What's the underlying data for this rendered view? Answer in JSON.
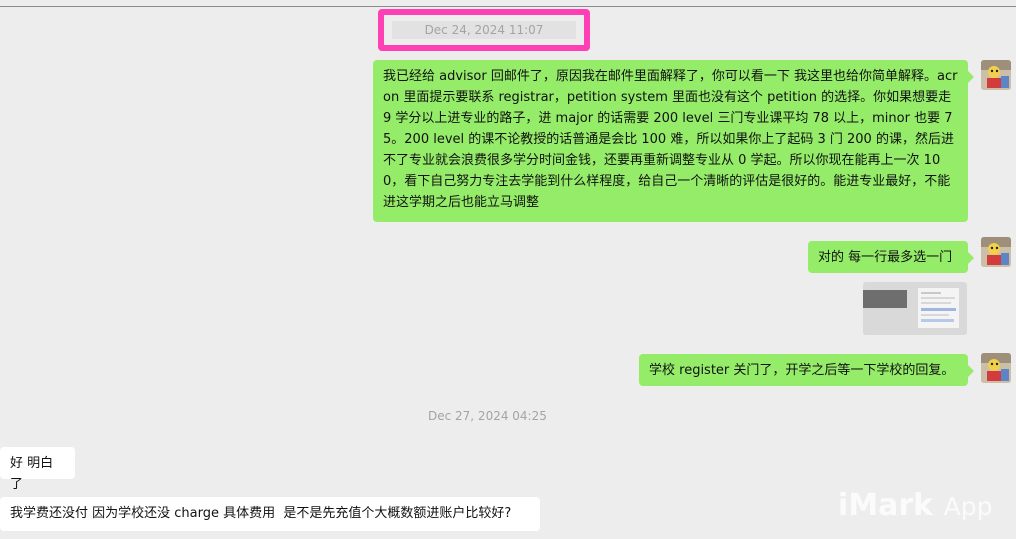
{
  "timestamps": {
    "first": "Dec 24, 2024 11:07",
    "second": "Dec 27, 2024 04:25"
  },
  "messages": {
    "m1": "我已经给 advisor 回邮件了，原因我在邮件里面解释了，你可以看一下 我这里也给你简单解释。acron 里面提示要联系 registrar，petition system 里面也没有这个 petition 的选择。你如果想要走 9 学分以上进专业的路子，进 major 的话需要 200 level 三门专业课平均 78 以上，minor 也要 75。200 level 的课不论教授的话普通是会比 100 难，所以如果你上了起码 3 门 200 的课，然后进不了专业就会浪费很多学分时间金钱，还要再重新调整专业从 0 学起。所以你现在能再上一次 100，看下自己努力专注去学能到什么样程度，给自己一个清晰的评估是很好的。能进专业最好，不能进这学期之后也能立马调整",
    "m2": "对的 每一行最多选一门",
    "m3": "学校 register 关门了，开学之后等一下学校的回复。",
    "m4": "好 明白了",
    "m5": "我学费还没付 因为学校还没 charge 具体费用  是不是先充值个大概数额进账户比较好?"
  },
  "watermark": {
    "brand": "iMark",
    "suffix": "App"
  },
  "colors": {
    "highlight": "#ff3fb4",
    "sent_bubble": "#95ec69",
    "received_bubble": "#ffffff",
    "background": "#ededed"
  },
  "icons": [
    "avatar-image",
    "image-thumbnail"
  ]
}
